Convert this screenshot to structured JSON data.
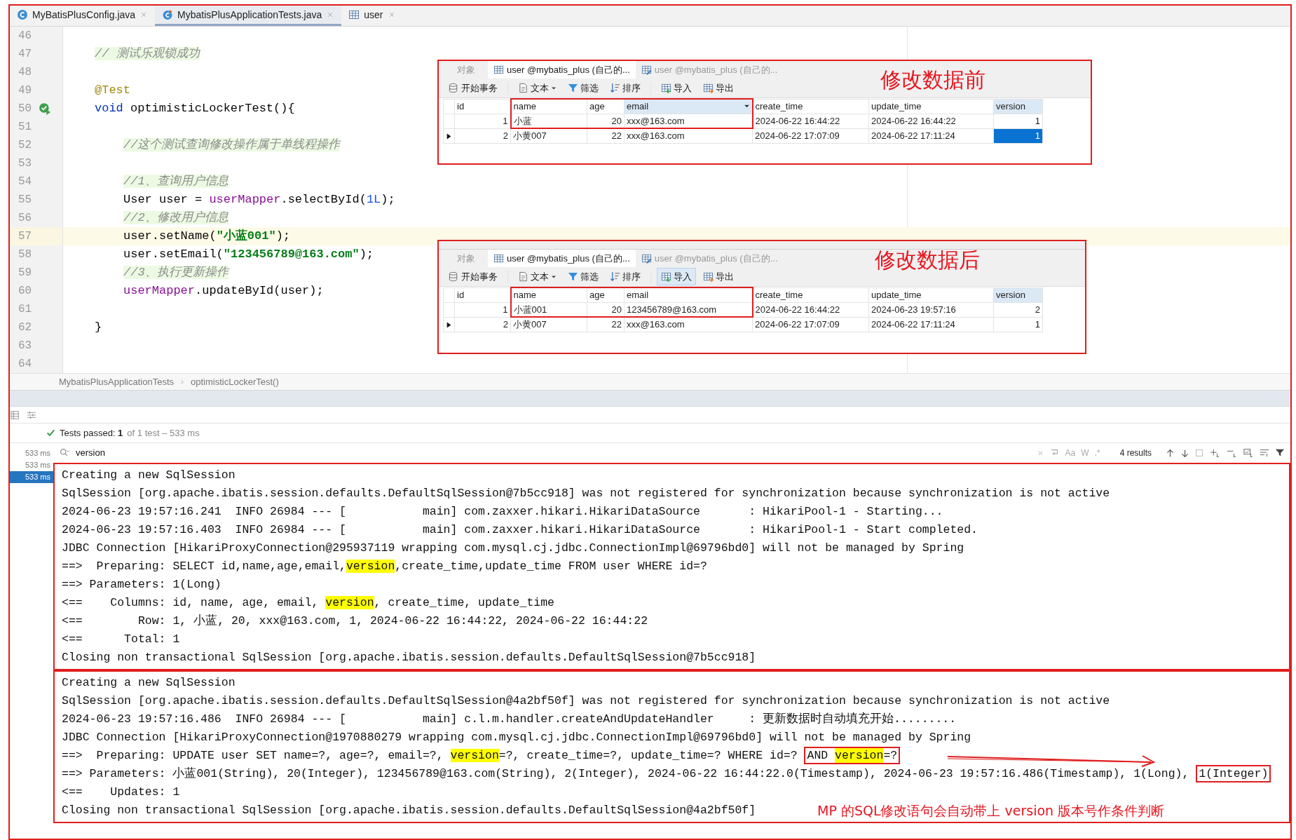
{
  "editor_tabs": [
    {
      "label": "MyBatisPlusConfig.java",
      "kind": "class",
      "selected": false
    },
    {
      "label": "MybatisPlusApplicationTests.java",
      "kind": "test",
      "selected": true
    },
    {
      "label": "user",
      "kind": "table",
      "selected": false
    }
  ],
  "code_lines": [
    {
      "number": "46",
      "current": false,
      "run_icon": false
    },
    {
      "number": "47",
      "kind": "member",
      "current": false,
      "run_icon": false,
      "segments": [
        {
          "text": "// 测试乐观锁成功",
          "kind": "comment"
        }
      ]
    },
    {
      "number": "48",
      "current": false,
      "run_icon": false
    },
    {
      "number": "49",
      "kind": "member",
      "current": false,
      "run_icon": false,
      "segments": [
        {
          "text": "@Test",
          "kind": "annotation"
        }
      ]
    },
    {
      "number": "50",
      "kind": "member",
      "current": false,
      "run_icon": true,
      "segments": [
        {
          "text": "void",
          "kind": "keyword"
        },
        {
          "text": " optimisticLockerTest(){",
          "kind": "plain"
        }
      ]
    },
    {
      "number": "51",
      "current": false,
      "run_icon": false
    },
    {
      "number": "52",
      "kind": "statement",
      "current": false,
      "run_icon": false,
      "segments": [
        {
          "text": "//这个测试查询修改操作属于单线程操作",
          "kind": "comment"
        }
      ]
    },
    {
      "number": "53",
      "current": false,
      "run_icon": false
    },
    {
      "number": "54",
      "kind": "statement",
      "current": false,
      "run_icon": false,
      "segments": [
        {
          "text": "//1、查询用户信息",
          "kind": "comment"
        }
      ]
    },
    {
      "number": "55",
      "kind": "statement",
      "current": false,
      "run_icon": false,
      "segments": [
        {
          "text": "User user = ",
          "kind": "plain"
        },
        {
          "text": "userMapper",
          "kind": "field"
        },
        {
          "text": ".selectById(",
          "kind": "plain"
        },
        {
          "text": "1L",
          "kind": "number"
        },
        {
          "text": ");",
          "kind": "plain"
        }
      ]
    },
    {
      "number": "56",
      "kind": "statement",
      "current": false,
      "run_icon": false,
      "segments": [
        {
          "text": "//2、修改用户信息",
          "kind": "comment"
        }
      ]
    },
    {
      "number": "57",
      "kind": "statement",
      "current": true,
      "run_icon": false,
      "segments": [
        {
          "text": "user.setName(",
          "kind": "plain"
        },
        {
          "text": "\"小蓝001\"",
          "kind": "string"
        },
        {
          "text": ");",
          "kind": "plain"
        }
      ]
    },
    {
      "number": "58",
      "kind": "statement",
      "current": false,
      "run_icon": false,
      "segments": [
        {
          "text": "user.setEmail(",
          "kind": "plain"
        },
        {
          "text": "\"123456789@163.com\"",
          "kind": "string"
        },
        {
          "text": ");",
          "kind": "plain"
        }
      ]
    },
    {
      "number": "59",
      "kind": "statement",
      "current": false,
      "run_icon": false,
      "segments": [
        {
          "text": "//3、执行更新操作",
          "kind": "comment"
        }
      ]
    },
    {
      "number": "60",
      "kind": "statement",
      "current": false,
      "run_icon": false,
      "segments": [
        {
          "text": "userMapper",
          "kind": "field"
        },
        {
          "text": ".updateById(user);",
          "kind": "plain"
        }
      ]
    },
    {
      "number": "61",
      "current": false,
      "run_icon": false
    },
    {
      "number": "62",
      "kind": "member",
      "current": false,
      "run_icon": false,
      "segments": [
        {
          "text": "}",
          "kind": "plain"
        }
      ]
    },
    {
      "number": "63",
      "current": false,
      "run_icon": false
    },
    {
      "number": "64",
      "current": false,
      "run_icon": false
    }
  ],
  "db_snapshots": [
    {
      "title": "修改数据前",
      "menu_strip": false,
      "tabs": [
        {
          "label": "对象",
          "kind": "objects",
          "selected": false
        },
        {
          "label": "user @mybatis_plus (自己的...",
          "kind": "table",
          "selected": true
        },
        {
          "label": "user @mybatis_plus (自己的...",
          "kind": "design",
          "selected": false
        }
      ],
      "toolbar": [
        {
          "label": "开始事务",
          "kind": "transaction",
          "pressed": false,
          "dropdown": false
        },
        {
          "label": "文本",
          "kind": "text",
          "pressed": false,
          "dropdown": true
        },
        {
          "label": "筛选",
          "kind": "filter",
          "pressed": false,
          "dropdown": false
        },
        {
          "label": "排序",
          "kind": "sort",
          "pressed": false,
          "dropdown": false
        },
        {
          "label": "导入",
          "kind": "import",
          "pressed": false,
          "dropdown": false
        },
        {
          "label": "导出",
          "kind": "export",
          "pressed": false,
          "dropdown": false
        }
      ],
      "columns": [
        {
          "label": "id",
          "kind": "number",
          "highlighted": false,
          "menu": false,
          "boxed": false
        },
        {
          "label": "name",
          "kind": "text",
          "highlighted": false,
          "menu": false,
          "boxed": true
        },
        {
          "label": "age",
          "kind": "number",
          "highlighted": false,
          "menu": false,
          "boxed": true
        },
        {
          "label": "email",
          "kind": "text",
          "highlighted": true,
          "menu": true,
          "boxed": true
        },
        {
          "label": "create_time",
          "kind": "text",
          "highlighted": false,
          "menu": false,
          "boxed": false
        },
        {
          "label": "update_time",
          "kind": "text",
          "highlighted": false,
          "menu": false,
          "boxed": false
        },
        {
          "label": "version",
          "kind": "number",
          "highlighted": true,
          "menu": false,
          "boxed": false
        }
      ],
      "rows": [
        {
          "current": false,
          "boxed": true,
          "cells": [
            {
              "text": "1",
              "selected": false
            },
            {
              "text": "小蓝",
              "selected": false
            },
            {
              "text": "20",
              "selected": false
            },
            {
              "text": "xxx@163.com",
              "selected": false
            },
            {
              "text": "2024-06-22 16:44:22",
              "selected": false
            },
            {
              "text": "2024-06-22 16:44:22",
              "selected": false
            },
            {
              "text": "1",
              "selected": false
            }
          ]
        },
        {
          "current": true,
          "boxed": false,
          "cells": [
            {
              "text": "2",
              "selected": false
            },
            {
              "text": "小黄007",
              "selected": false
            },
            {
              "text": "22",
              "selected": false
            },
            {
              "text": "xxx@163.com",
              "selected": false
            },
            {
              "text": "2024-06-22 17:07:09",
              "selected": false
            },
            {
              "text": "2024-06-22 17:11:24",
              "selected": false
            },
            {
              "text": "1",
              "selected": true
            }
          ]
        }
      ]
    },
    {
      "title": "修改数据后",
      "menu_strip": true,
      "tabs": [
        {
          "label": "对象",
          "kind": "objects",
          "selected": false
        },
        {
          "label": "user @mybatis_plus (自己的...",
          "kind": "table",
          "selected": true
        },
        {
          "label": "user @mybatis_plus (自己的...",
          "kind": "design",
          "selected": false
        }
      ],
      "toolbar": [
        {
          "label": "开始事务",
          "kind": "transaction",
          "pressed": false,
          "dropdown": false
        },
        {
          "label": "文本",
          "kind": "text",
          "pressed": false,
          "dropdown": true
        },
        {
          "label": "筛选",
          "kind": "filter",
          "pressed": false,
          "dropdown": false
        },
        {
          "label": "排序",
          "kind": "sort",
          "pressed": false,
          "dropdown": false
        },
        {
          "label": "导入",
          "kind": "import",
          "pressed": true,
          "dropdown": false
        },
        {
          "label": "导出",
          "kind": "export",
          "pressed": false,
          "dropdown": false
        }
      ],
      "columns": [
        {
          "label": "id",
          "kind": "number",
          "highlighted": false,
          "menu": false,
          "boxed": false
        },
        {
          "label": "name",
          "kind": "text",
          "highlighted": false,
          "menu": false,
          "boxed": true
        },
        {
          "label": "age",
          "kind": "number",
          "highlighted": false,
          "menu": false,
          "boxed": true
        },
        {
          "label": "email",
          "kind": "text",
          "highlighted": false,
          "menu": false,
          "boxed": true
        },
        {
          "label": "create_time",
          "kind": "text",
          "highlighted": false,
          "menu": false,
          "boxed": false
        },
        {
          "label": "update_time",
          "kind": "text",
          "highlighted": false,
          "menu": false,
          "boxed": false
        },
        {
          "label": "version",
          "kind": "number",
          "highlighted": true,
          "menu": false,
          "boxed": false
        }
      ],
      "rows": [
        {
          "current": false,
          "boxed": true,
          "cells": [
            {
              "text": "1",
              "selected": false
            },
            {
              "text": "小蓝001",
              "selected": false
            },
            {
              "text": "20",
              "selected": false
            },
            {
              "text": "123456789@163.com",
              "selected": false
            },
            {
              "text": "2024-06-22 16:44:22",
              "selected": false
            },
            {
              "text": "2024-06-23 19:57:16",
              "selected": false
            },
            {
              "text": "2",
              "selected": false
            }
          ]
        },
        {
          "current": true,
          "boxed": false,
          "cells": [
            {
              "text": "2",
              "selected": false
            },
            {
              "text": "小黄007",
              "selected": false
            },
            {
              "text": "22",
              "selected": false
            },
            {
              "text": "xxx@163.com",
              "selected": false
            },
            {
              "text": "2024-06-22 17:07:09",
              "selected": false
            },
            {
              "text": "2024-06-22 17:11:24",
              "selected": false
            },
            {
              "text": "1",
              "selected": false
            }
          ]
        }
      ]
    }
  ],
  "breadcrumb": [
    "MybatisPlusApplicationTests",
    "optimisticLockerTest()"
  ],
  "test_status": {
    "passed": true,
    "text": "Tests passed: **1**",
    "detail": "of 1 test – 533 ms"
  },
  "test_tree": [
    {
      "time": "533 ms",
      "selected": false
    },
    {
      "time": "533 ms",
      "selected": false
    },
    {
      "time": "533 ms",
      "selected": true
    }
  ],
  "search": {
    "value": "version",
    "options": [
      "Aa",
      "W",
      ".*"
    ],
    "results": "4 results"
  },
  "console_blocks": [
    {
      "lines": [
        {
          "text": "Creating a new SqlSession"
        },
        {
          "text": "SqlSession [org.apache.ibatis.session.defaults.DefaultSqlSession@7b5cc918] was not registered for synchronization because synchronization is not active"
        },
        {
          "text": "2024-06-23 19:57:16.241  INFO 26984 --- [           main] com.zaxxer.hikari.HikariDataSource       : HikariPool-1 - Starting..."
        },
        {
          "text": "2024-06-23 19:57:16.403  INFO 26984 --- [           main] com.zaxxer.hikari.HikariDataSource       : HikariPool-1 - Start completed."
        },
        {
          "text": "JDBC Connection [HikariProxyConnection@295937119 wrapping com.mysql.cj.jdbc.ConnectionImpl@69796bd0] will not be managed by Spring"
        },
        {
          "segments": [
            {
              "text": "==>  Preparing: SELECT id,name,age,email,",
              "match": false,
              "boxed": false
            },
            {
              "text": "version",
              "match": true,
              "boxed": false
            },
            {
              "text": ",create_time,update_time FROM user WHERE id=?",
              "match": false,
              "boxed": false
            }
          ]
        },
        {
          "text": "==> Parameters: 1(Long)"
        },
        {
          "segments": [
            {
              "text": "<==    Columns: id, name, age, email, ",
              "match": false,
              "boxed": false
            },
            {
              "text": "version",
              "match": true,
              "boxed": false
            },
            {
              "text": ", create_time, update_time",
              "match": false,
              "boxed": false
            }
          ]
        },
        {
          "text": "<==        Row: 1, 小蓝, 20, xxx@163.com, 1, 2024-06-22 16:44:22, 2024-06-22 16:44:22"
        },
        {
          "text": "<==      Total: 1"
        },
        {
          "text": "Closing non transactional SqlSession [org.apache.ibatis.session.defaults.DefaultSqlSession@7b5cc918]"
        }
      ]
    },
    {
      "lines": [
        {
          "text": "Creating a new SqlSession"
        },
        {
          "text": "SqlSession [org.apache.ibatis.session.defaults.DefaultSqlSession@4a2bf50f] was not registered for synchronization because synchronization is not active"
        },
        {
          "text": "2024-06-23 19:57:16.486  INFO 26984 --- [           main] c.l.m.handler.createAndUpdateHandler     : 更新数据时自动填充开始........."
        },
        {
          "text": "JDBC Connection [HikariProxyConnection@1970880279 wrapping com.mysql.cj.jdbc.ConnectionImpl@69796bd0] will not be managed by Spring"
        },
        {
          "arrow": true,
          "segments": [
            {
              "text": "==>  Preparing: UPDATE user SET name=?, age=?, email=?, ",
              "match": false,
              "boxed": false
            },
            {
              "text": "version",
              "match": true,
              "boxed": false
            },
            {
              "text": "=?, create_time=?, update_time=? WHERE id=? ",
              "match": false,
              "boxed": false
            },
            {
              "text": "AND ",
              "match": false,
              "boxed": true
            },
            {
              "text": "version",
              "match": true,
              "boxed": true
            },
            {
              "text": "=?",
              "match": false,
              "boxed": true
            }
          ]
        },
        {
          "segments": [
            {
              "text": "==> Parameters: 小蓝001(String), 20(Integer), 123456789@163.com(String), 2(Integer), 2024-06-22 16:44:22.0(Timestamp), 2024-06-23 19:57:16.486(Timestamp), 1(Long), ",
              "match": false,
              "boxed": false
            },
            {
              "text": "1(Integer)",
              "match": false,
              "boxed": true
            }
          ]
        },
        {
          "text": "<==    Updates: 1"
        },
        {
          "text": "Closing non transactional SqlSession [org.apache.ibatis.session.defaults.DefaultSqlSession@4a2bf50f]",
          "note": "MP 的SQL修改语句会自动带上 version 版本号作条件判断"
        }
      ]
    }
  ]
}
